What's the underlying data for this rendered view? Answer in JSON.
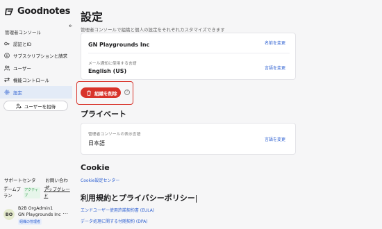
{
  "brand": {
    "name": "Goodnotes"
  },
  "sidebar": {
    "section_label": "管理者コンソール",
    "items": [
      {
        "label": "認証とID",
        "icon": "key-icon"
      },
      {
        "label": "サブスクリプションと請求",
        "icon": "dollar-icon"
      },
      {
        "label": "ユーザー",
        "icon": "users-icon"
      },
      {
        "label": "機能コントロール",
        "icon": "toggle-icon"
      },
      {
        "label": "設定",
        "icon": "gear-icon",
        "active": true
      }
    ],
    "invite_label": "ユーザーを招待",
    "support_label": "サポートセンター",
    "contact_label": "お問い合わせ",
    "plan": {
      "name": "チームプラン",
      "badge": "アクティブ",
      "upgrade": "アップグレード"
    },
    "user": {
      "initials": "BO",
      "name": "B2B OrgAdmin1",
      "org": "GN Playgrounds Inc",
      "role": "組織の管理者"
    }
  },
  "main": {
    "title": "設定",
    "subtitle": "管理者コンソールで組織と個人の設定をそれぞれカスタマイズできます",
    "org_card": {
      "org_name": "GN Playgrounds Inc",
      "rename_link": "名前を変更",
      "email_lang_label": "メール通知に使用する言語",
      "email_lang_value": "English (US)",
      "change_lang_link": "言語を変更"
    },
    "delete_button": "組織を削除",
    "private": {
      "heading": "プライベート",
      "lang_label": "管理者コンソールの表示言語",
      "lang_value": "日本語",
      "change_lang_link": "言語を変更"
    },
    "cookie": {
      "heading": "Cookie",
      "link": "Cookie設定センター"
    },
    "terms": {
      "heading": "利用規約とプライバシーポリシー",
      "eula_link": "エンドユーザー使用許諾契約書 (EULA)",
      "dpa_link": "データ処理に関する付随契約 (DPA)"
    }
  },
  "colors": {
    "accent": "#2c5fd1",
    "danger": "#d8332a",
    "active_bg": "#e3ebf7"
  }
}
